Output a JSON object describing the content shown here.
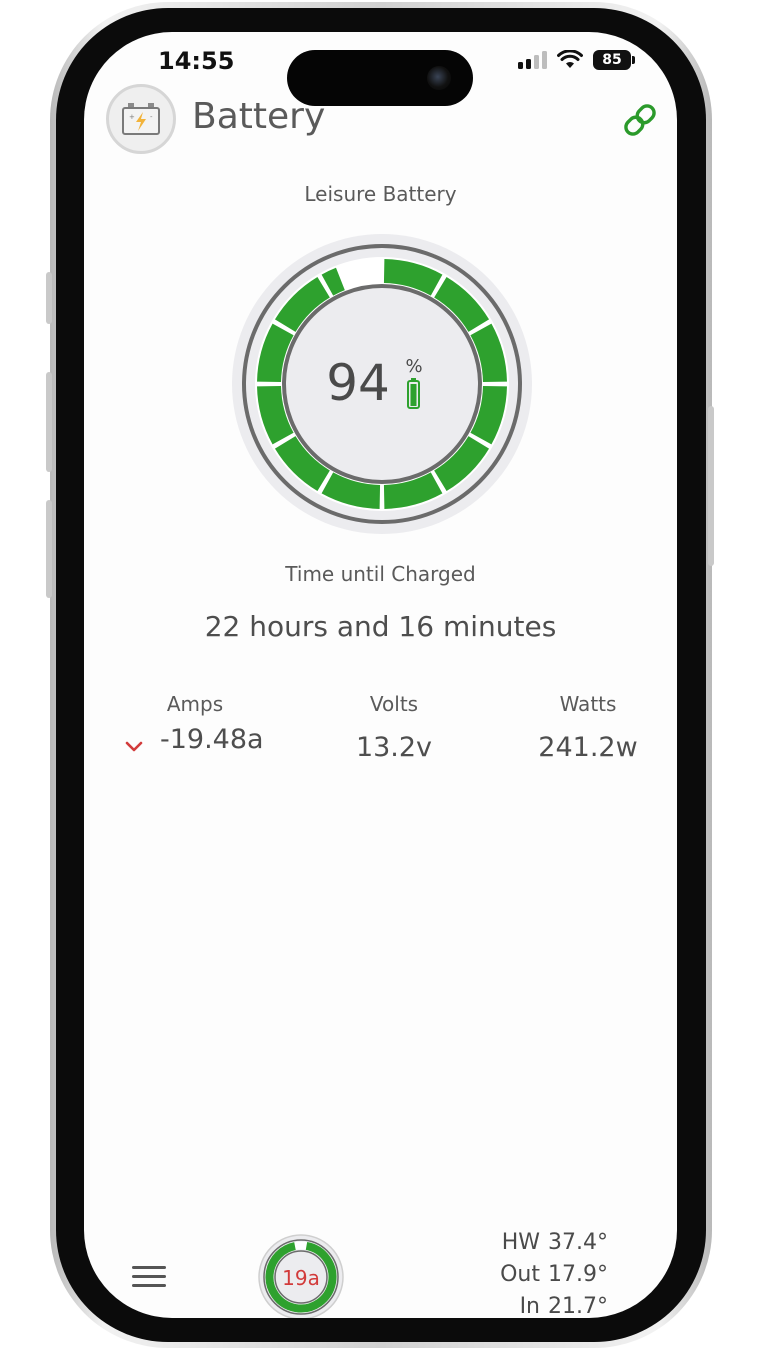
{
  "status_bar": {
    "time": "14:55",
    "battery_level": "85"
  },
  "header": {
    "title": "Battery"
  },
  "battery_section": {
    "label": "Leisure Battery",
    "charge_percent": 94,
    "charge_value": "94",
    "charge_unit": "%"
  },
  "charging": {
    "label": "Time until Charged",
    "value": "22 hours and 16 minutes"
  },
  "metrics": {
    "amps": {
      "label": "Amps",
      "value": "-19.48a",
      "trend": "down"
    },
    "volts": {
      "label": "Volts",
      "value": "13.2v"
    },
    "watts": {
      "label": "Watts",
      "value": "241.2w"
    }
  },
  "bottom_bar": {
    "mini_gauge_value": "19a",
    "temps": [
      {
        "label": "HW",
        "value": "37.4°"
      },
      {
        "label": "Out",
        "value": "17.9°"
      },
      {
        "label": "In",
        "value": "21.7°"
      }
    ]
  },
  "colors": {
    "accent_green": "#2ea12e",
    "link_green": "#2b9a2b",
    "amps_red": "#d23b3b",
    "ring_gray": "#6b6b6b"
  }
}
